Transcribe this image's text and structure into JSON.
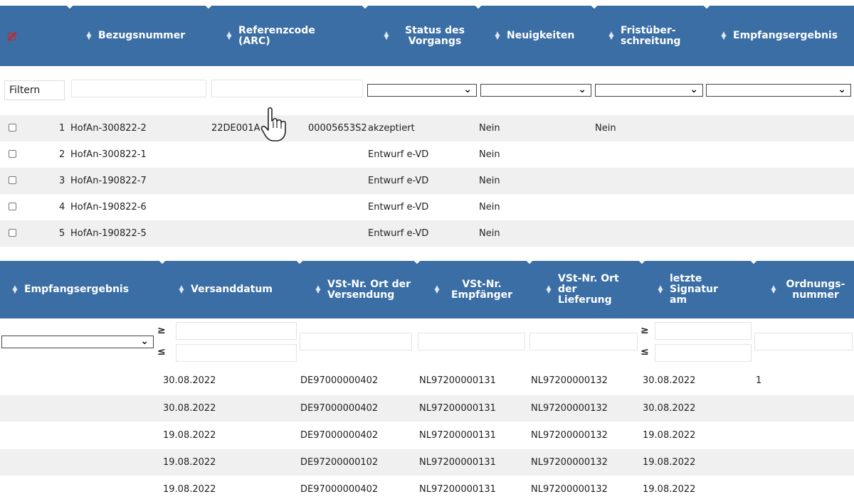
{
  "table1": {
    "header": {
      "icon": "unchecked-marker-icon",
      "columns": [
        {
          "label": "Bezugsnummer"
        },
        {
          "label": "Referenzcode (ARC)"
        },
        {
          "label": "Status des Vorgangs"
        },
        {
          "label": "Neuigkeiten"
        },
        {
          "label": "Fristüber- schreitung"
        },
        {
          "label": "Empfangsergebnis"
        }
      ]
    },
    "filter": {
      "button": "Filtern"
    },
    "rows": [
      {
        "num": "1",
        "bezug": "HofAn-300822-2",
        "arc": "22DE001A",
        "arc_tail": "00005653S2",
        "status": "akzeptiert",
        "news": "Nein",
        "frist": "Nein"
      },
      {
        "num": "2",
        "bezug": "HofAn-300822-1",
        "arc": "",
        "arc_tail": "",
        "status": "Entwurf e-VD",
        "news": "Nein",
        "frist": ""
      },
      {
        "num": "3",
        "bezug": "HofAn-190822-7",
        "arc": "",
        "arc_tail": "",
        "status": "Entwurf e-VD",
        "news": "Nein",
        "frist": ""
      },
      {
        "num": "4",
        "bezug": "HofAn-190822-6",
        "arc": "",
        "arc_tail": "",
        "status": "Entwurf e-VD",
        "news": "Nein",
        "frist": ""
      },
      {
        "num": "5",
        "bezug": "HofAn-190822-5",
        "arc": "",
        "arc_tail": "",
        "status": "Entwurf e-VD",
        "news": "Nein",
        "frist": ""
      }
    ]
  },
  "table2": {
    "header": {
      "columns": [
        {
          "label": "Empfangsergebnis"
        },
        {
          "label": "Versanddatum"
        },
        {
          "label": "VSt-Nr. Ort der Versendung"
        },
        {
          "label": "VSt-Nr. Empfänger"
        },
        {
          "label": "VSt-Nr. Ort der Lieferung"
        },
        {
          "label": "letzte Signatur am"
        },
        {
          "label": "Ordnungs- nummer"
        }
      ]
    },
    "filter": {
      "ge": "≥",
      "le": "≤"
    },
    "rows": [
      {
        "versand": "30.08.2022",
        "ort_vers": "DE97000000402",
        "empf": "NL97200000131",
        "ort_lief": "NL97200000132",
        "signatur": "30.08.2022",
        "ordnung": "1"
      },
      {
        "versand": "30.08.2022",
        "ort_vers": "DE97000000402",
        "empf": "NL97200000131",
        "ort_lief": "NL97200000132",
        "signatur": "30.08.2022",
        "ordnung": ""
      },
      {
        "versand": "19.08.2022",
        "ort_vers": "DE97000000402",
        "empf": "NL97200000131",
        "ort_lief": "NL97200000132",
        "signatur": "19.08.2022",
        "ordnung": ""
      },
      {
        "versand": "19.08.2022",
        "ort_vers": "DE97200000102",
        "empf": "NL97200000131",
        "ort_lief": "NL97200000132",
        "signatur": "19.08.2022",
        "ordnung": ""
      },
      {
        "versand": "19.08.2022",
        "ort_vers": "DE97000000402",
        "empf": "NL97200000131",
        "ort_lief": "NL97200000132",
        "signatur": "19.08.2022",
        "ordnung": ""
      }
    ]
  },
  "cursor": {
    "icon": "hand-pointer-icon"
  }
}
